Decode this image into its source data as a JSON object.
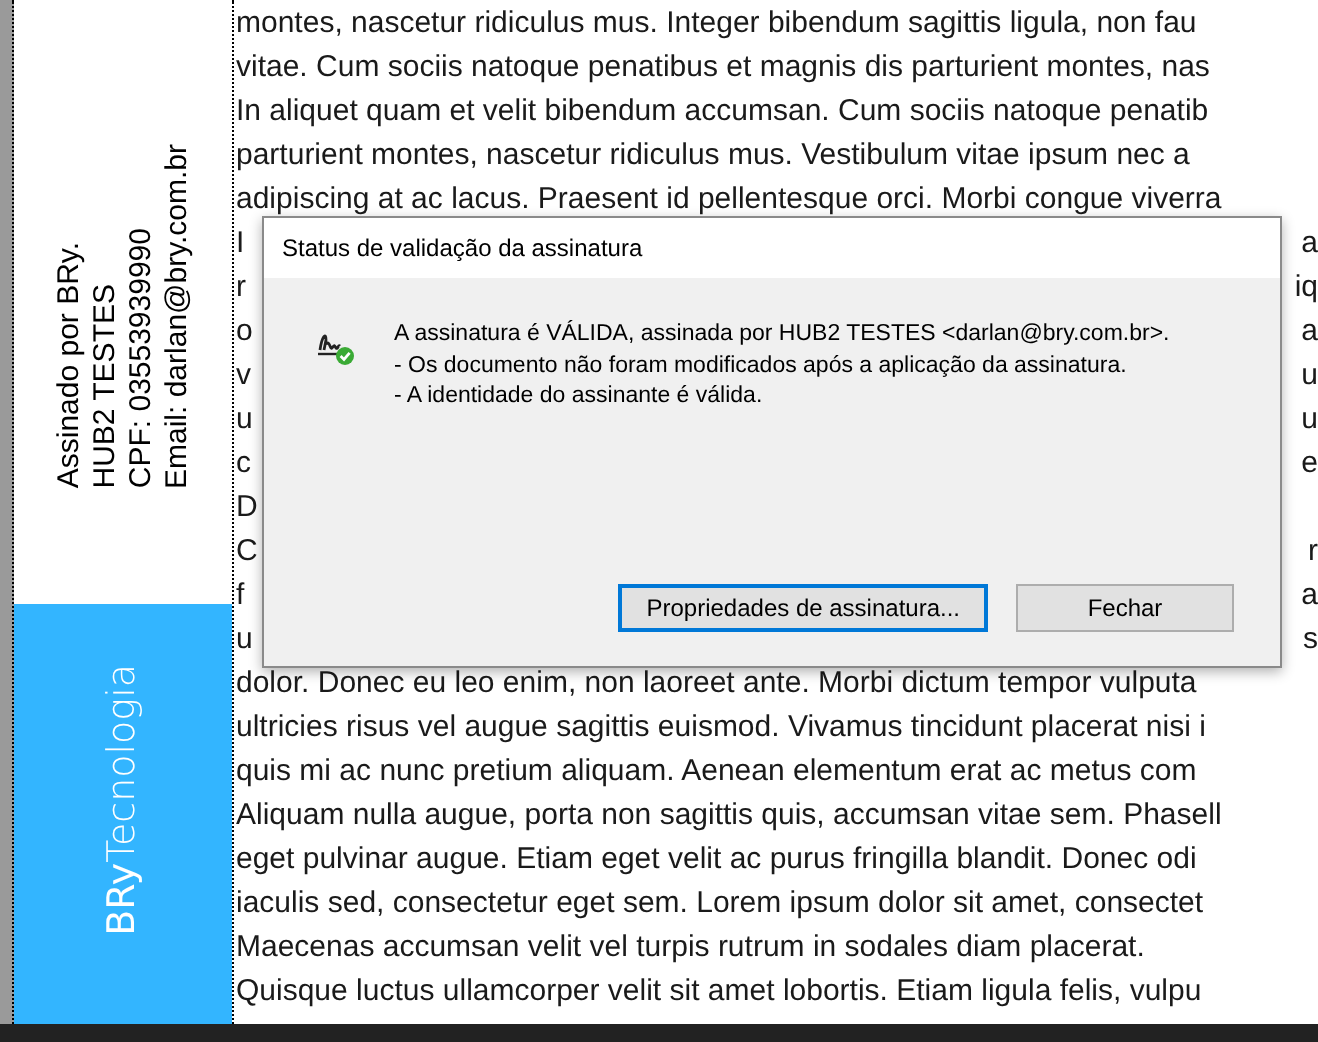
{
  "signature_stamp": {
    "lines": [
      "Assinado por BRy.",
      "HUB2 TESTES",
      "CPF: 03553939990",
      "Email: darlan@bry.com.br"
    ]
  },
  "brand_banner": {
    "text": "**BRy**Tecnologia"
  },
  "document": {
    "lines": [
      {
        "kind": "full",
        "text": "montes, nascetur ridiculus mus. Integer bibendum sagittis ligula, non fau"
      },
      {
        "kind": "full",
        "text": "vitae. Cum sociis natoque penatibus et magnis dis parturient montes, nas"
      },
      {
        "kind": "full",
        "text": "In aliquet quam et velit bibendum accumsan. Cum sociis natoque penatib"
      },
      {
        "kind": "full",
        "text": "parturient montes, nascetur ridiculus mus. Vestibulum vitae ipsum nec a"
      },
      {
        "kind": "full",
        "text": "adipiscing at ac lacus. Praesent id pellentesque orci. Morbi congue viverra"
      },
      {
        "kind": "split",
        "left": "I",
        "right": "a"
      },
      {
        "kind": "split",
        "left": "r",
        "right": "iq"
      },
      {
        "kind": "split",
        "left": "o",
        "right": "a"
      },
      {
        "kind": "split",
        "left": "v",
        "right": "u"
      },
      {
        "kind": "split",
        "left": "u",
        "right": "u"
      },
      {
        "kind": "split",
        "left": "c",
        "right": "e"
      },
      {
        "kind": "split",
        "left": "D"
      },
      {
        "kind": "split",
        "left": "C",
        "right": "r"
      },
      {
        "kind": "split",
        "left": "f",
        "right": "a"
      },
      {
        "kind": "split",
        "left": "u",
        "right": "s"
      },
      {
        "kind": "full",
        "text": "dolor. Donec eu leo enim, non laoreet ante. Morbi dictum tempor vulputa"
      },
      {
        "kind": "full",
        "text": "ultricies risus vel augue sagittis euismod. Vivamus tincidunt placerat nisi i"
      },
      {
        "kind": "full",
        "text": "quis mi ac nunc pretium aliquam. Aenean elementum erat ac metus com"
      },
      {
        "kind": "full",
        "text": "Aliquam nulla augue, porta non sagittis quis, accumsan vitae sem. Phasell"
      },
      {
        "kind": "full",
        "text": "eget pulvinar augue. Etiam eget velit ac purus fringilla blandit. Donec odi"
      },
      {
        "kind": "full",
        "text": "iaculis sed, consectetur eget sem. Lorem ipsum dolor sit amet, consectet"
      },
      {
        "kind": "full",
        "text": "Maecenas accumsan velit vel turpis rutrum in sodales diam placerat."
      },
      {
        "kind": "full",
        "text": "Quisque luctus ullamcorper velit sit amet lobortis. Etiam ligula felis, vulpu"
      }
    ]
  },
  "dialog": {
    "title": "Status de validação da assinatura",
    "message_lines": [
      "A assinatura é VÁLIDA, assinada por HUB2 TESTES <darlan@bry.com.br>.",
      "- Os documento não foram modificados após a aplicação da assinatura.",
      "- A identidade do assinante é válida."
    ],
    "buttons": [
      {
        "label": "Propriedades de assinatura...",
        "selected": true
      },
      {
        "label": "Fechar",
        "selected": false
      }
    ]
  }
}
